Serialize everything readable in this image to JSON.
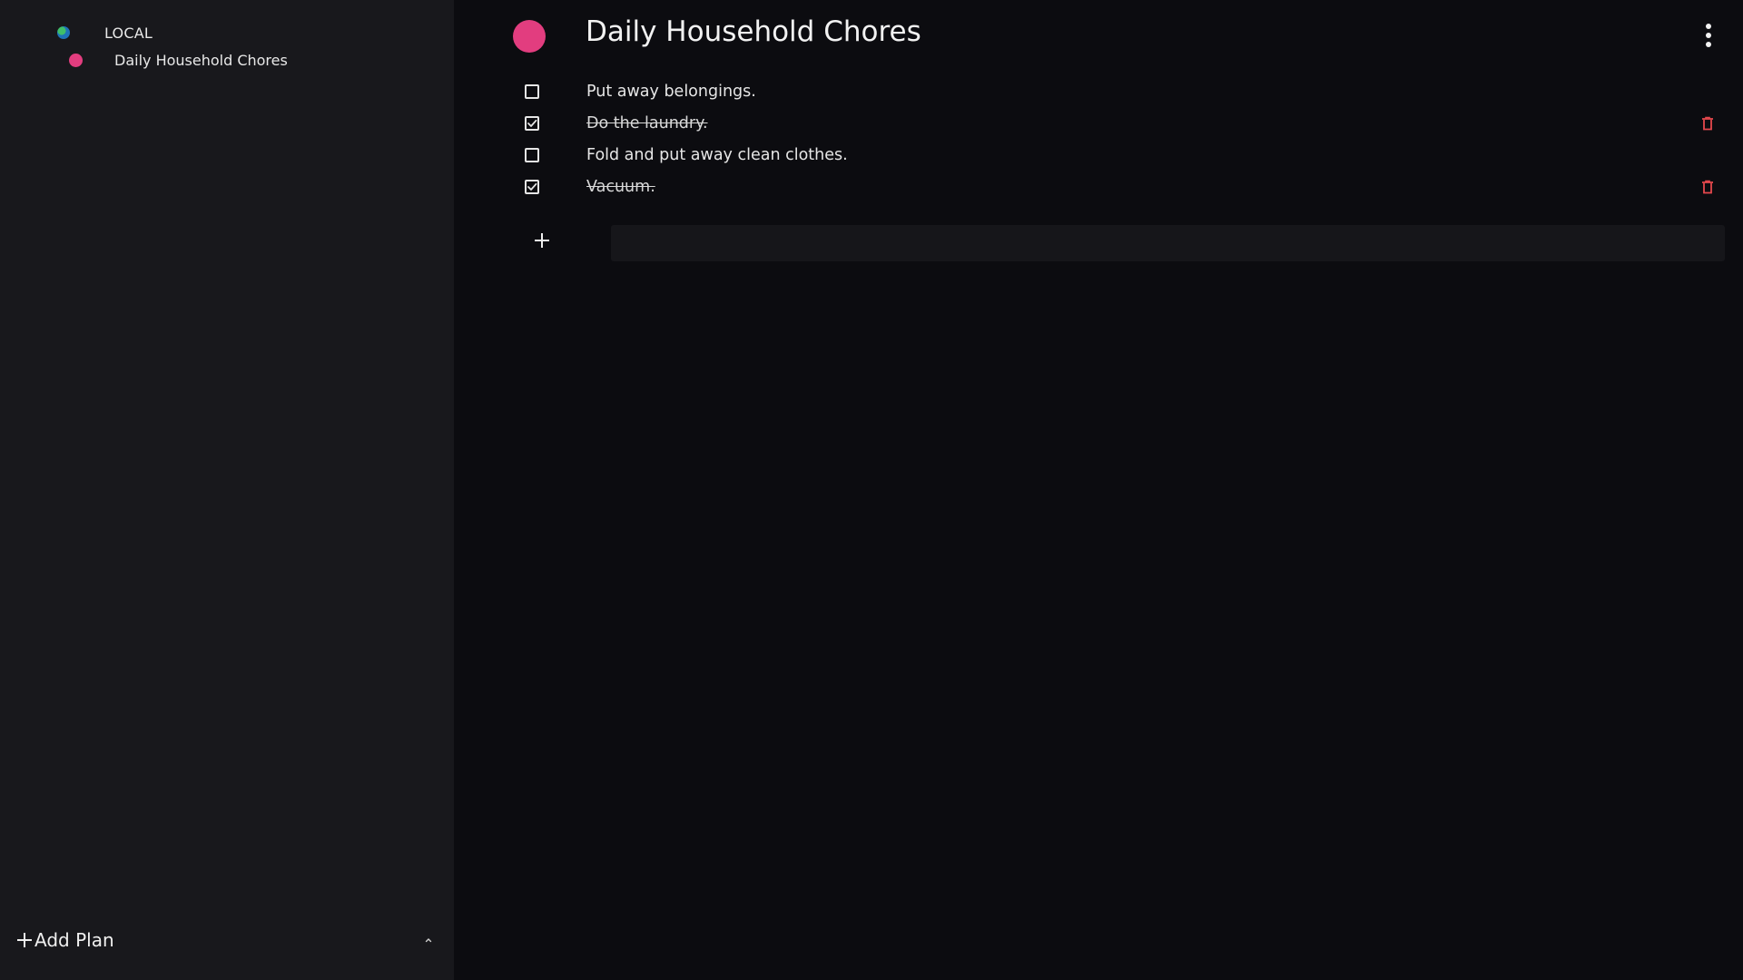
{
  "sidebar": {
    "group": {
      "label": "LOCAL",
      "icon": "globe-icon"
    },
    "plans": [
      {
        "label": "Daily Household Chores",
        "color": "#e23d7f"
      }
    ],
    "add_plan_label": "Add Plan",
    "add_plan_icon": "plus-icon",
    "collapse_icon": "chevron-up-icon"
  },
  "main": {
    "title": "Daily Household Chores",
    "title_color": "#e23d7f",
    "more_icon": "more-vertical-icon",
    "tasks": [
      {
        "text": "Put away belongings.",
        "done": false
      },
      {
        "text": "Do the laundry.",
        "done": true
      },
      {
        "text": "Fold and put away clean clothes.",
        "done": false
      },
      {
        "text": "Vacuum.",
        "done": true
      }
    ],
    "delete_icon_color": "#e5484d",
    "add_task_icon": "plus-icon",
    "add_task_placeholder": ""
  }
}
